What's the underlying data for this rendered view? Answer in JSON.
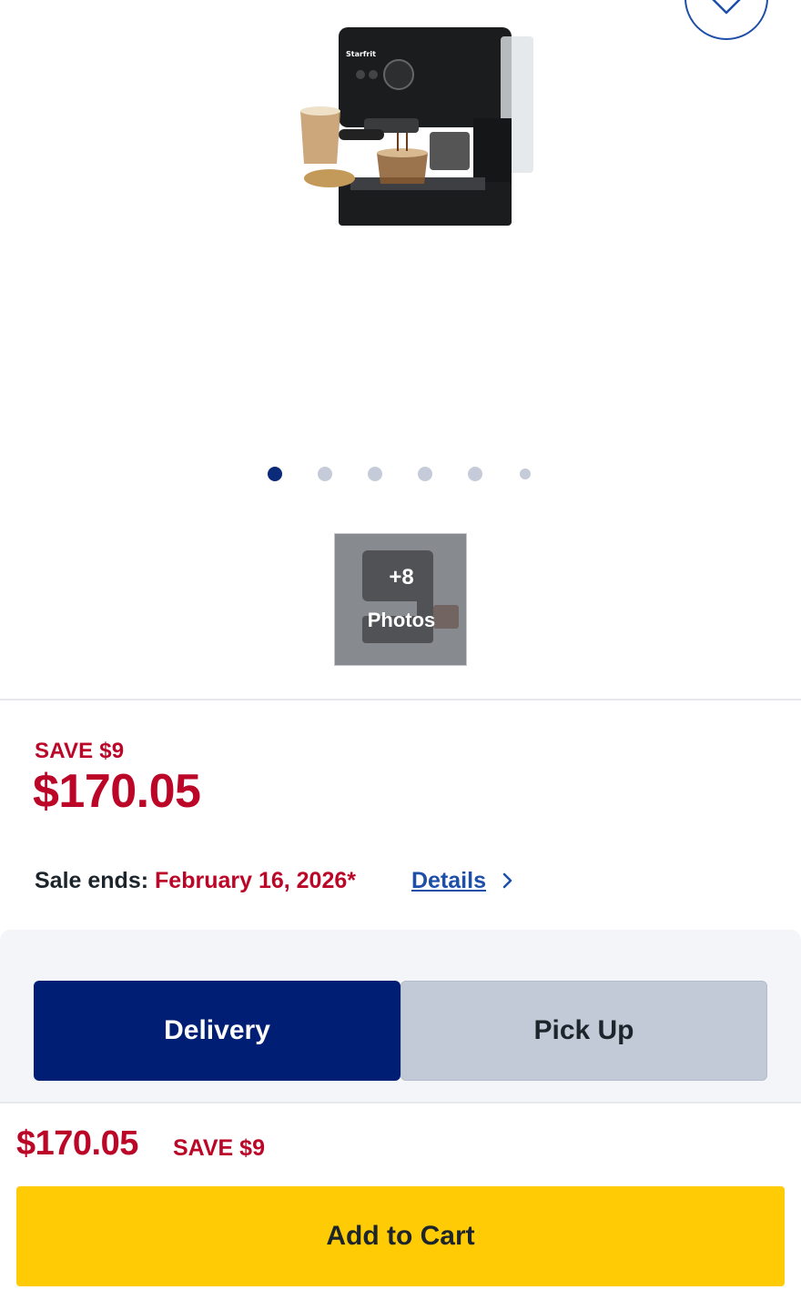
{
  "product": {
    "image_icon": "espresso-machine-image",
    "brand_mark": "Starfrit",
    "carousel": {
      "total_dots": 6,
      "active_index": 0
    },
    "photos_thumb": {
      "count": "+8",
      "label": "Photos"
    }
  },
  "pricing": {
    "save_label": "SAVE $9",
    "price": "$170.05",
    "sale_ends_label": "Sale ends:",
    "sale_ends_date": "February 16, 2026*",
    "details_link": "Details"
  },
  "fulfillment": {
    "delivery_label": "Delivery",
    "pickup_label": "Pick Up",
    "selected": "Delivery"
  },
  "sticky_bar": {
    "price": "$170.05",
    "save_label": "SAVE $9",
    "add_to_cart_label": "Add to Cart"
  },
  "colors": {
    "sale_red": "#bb0628",
    "brand_blue": "#001e73",
    "link_blue": "#1d4fa8",
    "cart_yellow": "#ffcb05"
  }
}
